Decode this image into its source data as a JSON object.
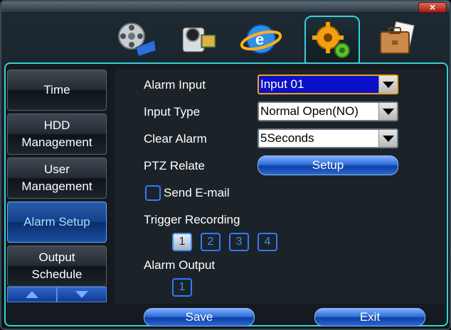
{
  "window": {
    "close_label": "×"
  },
  "tabs": [
    {
      "icon": "film-reel-icon"
    },
    {
      "icon": "camcorder-icon"
    },
    {
      "icon": "network-globe-icon"
    },
    {
      "icon": "gears-icon",
      "active": true
    },
    {
      "icon": "briefcase-icon"
    }
  ],
  "sidebar": {
    "items": [
      {
        "label": "Time"
      },
      {
        "label_line1": "HDD",
        "label_line2": "Management"
      },
      {
        "label_line1": "User",
        "label_line2": "Management"
      },
      {
        "label": "Alarm Setup",
        "active": true
      },
      {
        "label_line1": "Output",
        "label_line2": "Schedule"
      }
    ]
  },
  "form": {
    "alarm_input_label": "Alarm Input",
    "alarm_input_value": "Input 01",
    "input_type_label": "Input Type",
    "input_type_value": "Normal Open(NO)",
    "clear_alarm_label": "Clear Alarm",
    "clear_alarm_value": "5Seconds",
    "ptz_relate_label": "PTZ Relate",
    "setup_button": "Setup",
    "send_email_label": "Send E-mail",
    "send_email_checked": false,
    "trigger_recording_label": "Trigger Recording",
    "trigger_channels": [
      "1",
      "2",
      "3",
      "4"
    ],
    "trigger_checked": [
      true,
      false,
      false,
      false
    ],
    "alarm_output_label": "Alarm Output",
    "alarm_outputs": [
      "1"
    ]
  },
  "footer": {
    "save_label": "Save",
    "exit_label": "Exit"
  },
  "colors": {
    "accent_cyan": "#38d0d8",
    "selection_blue": "#0a10c8",
    "focus_orange": "#f0a020"
  }
}
